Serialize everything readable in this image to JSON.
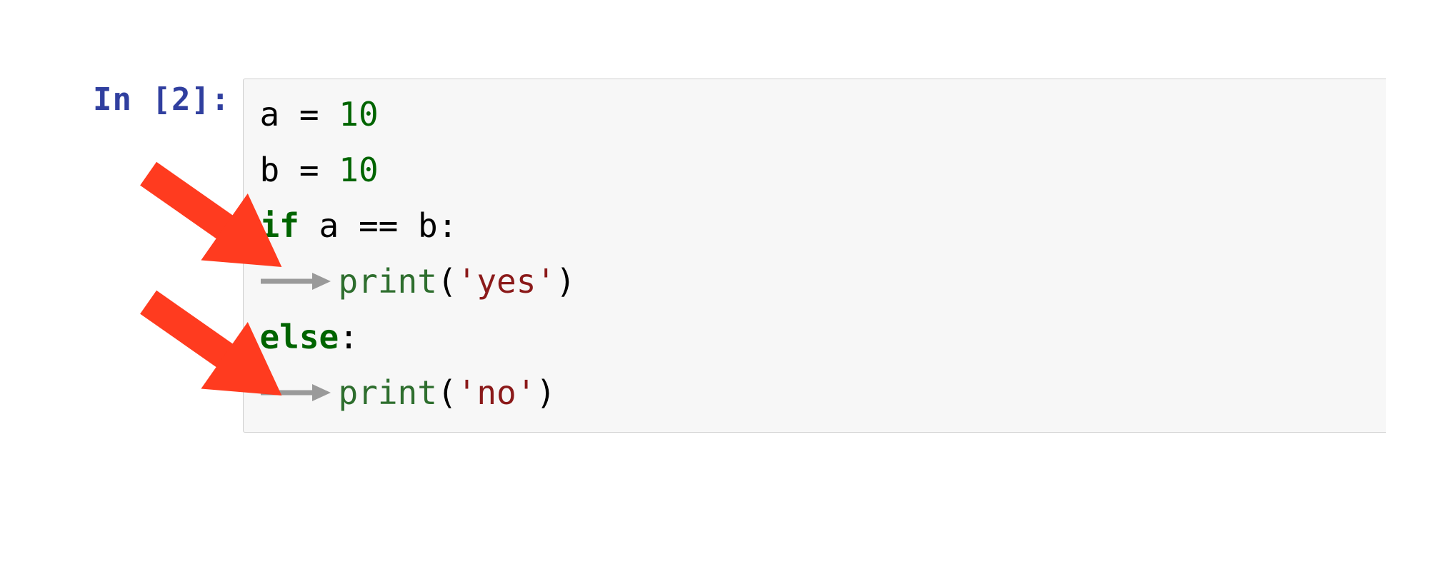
{
  "prompt": {
    "label": "In [2]:"
  },
  "code": {
    "line1": {
      "a": "a",
      "sp1": " ",
      "eq": "=",
      "sp2": " ",
      "val": "10"
    },
    "line2": {
      "b": "b",
      "sp1": " ",
      "eq": "=",
      "sp2": " ",
      "val": "10"
    },
    "line3": {
      "if": "if",
      "sp1": " ",
      "a": "a",
      "sp2": " ",
      "op": "==",
      "sp3": " ",
      "b": "b",
      "colon": ":"
    },
    "line4": {
      "func": "print",
      "open": "(",
      "str": "'yes'",
      "close": ")"
    },
    "line5": {
      "else": "else",
      "colon": ":"
    },
    "line6": {
      "func": "print",
      "open": "(",
      "str": "'no'",
      "close": ")"
    }
  },
  "icons": {
    "tab_indicator": "tab-arrow-icon",
    "annotation_arrow": "red-arrow-icon"
  }
}
